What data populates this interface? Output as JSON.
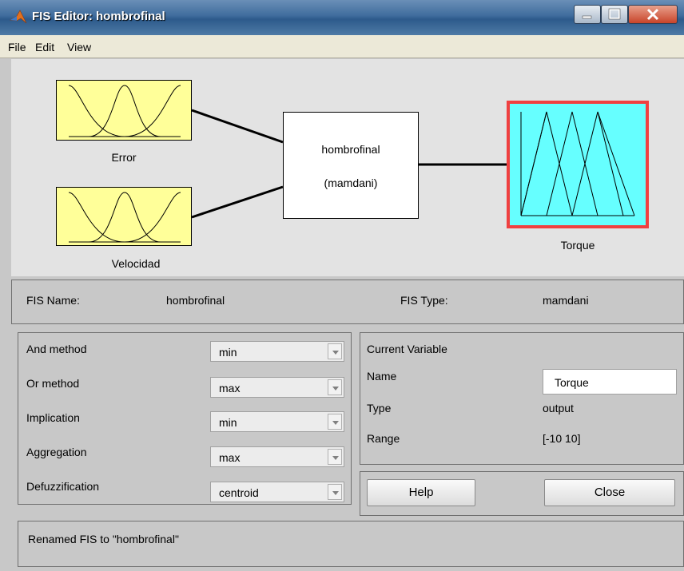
{
  "window": {
    "title": "FIS Editor: hombrofinal"
  },
  "menu": [
    "File",
    "Edit",
    "View"
  ],
  "diagram": {
    "inputs": [
      "Error",
      "Velocidad"
    ],
    "system_name": "hombrofinal",
    "system_type": "(mamdani)",
    "output": "Torque"
  },
  "fis": {
    "name_label": "FIS Name:",
    "name_value": "hombrofinal",
    "type_label": "FIS Type:",
    "type_value": "mamdani"
  },
  "methods": [
    {
      "label": "And method",
      "value": "min"
    },
    {
      "label": "Or method",
      "value": "max"
    },
    {
      "label": "Implication",
      "value": "min"
    },
    {
      "label": "Aggregation",
      "value": "max"
    },
    {
      "label": "Defuzzification",
      "value": "centroid"
    }
  ],
  "current_variable": {
    "heading": "Current Variable",
    "name_label": "Name",
    "name_value": "Torque",
    "type_label": "Type",
    "type_value": "output",
    "range_label": "Range",
    "range_value": "[-10 10]"
  },
  "buttons": {
    "help": "Help",
    "close": "Close"
  },
  "status": "Renamed FIS to \"hombrofinal\"",
  "colors": {
    "input_box": "#ffff99",
    "output_box": "#66ffff",
    "output_border": "#f04040"
  }
}
